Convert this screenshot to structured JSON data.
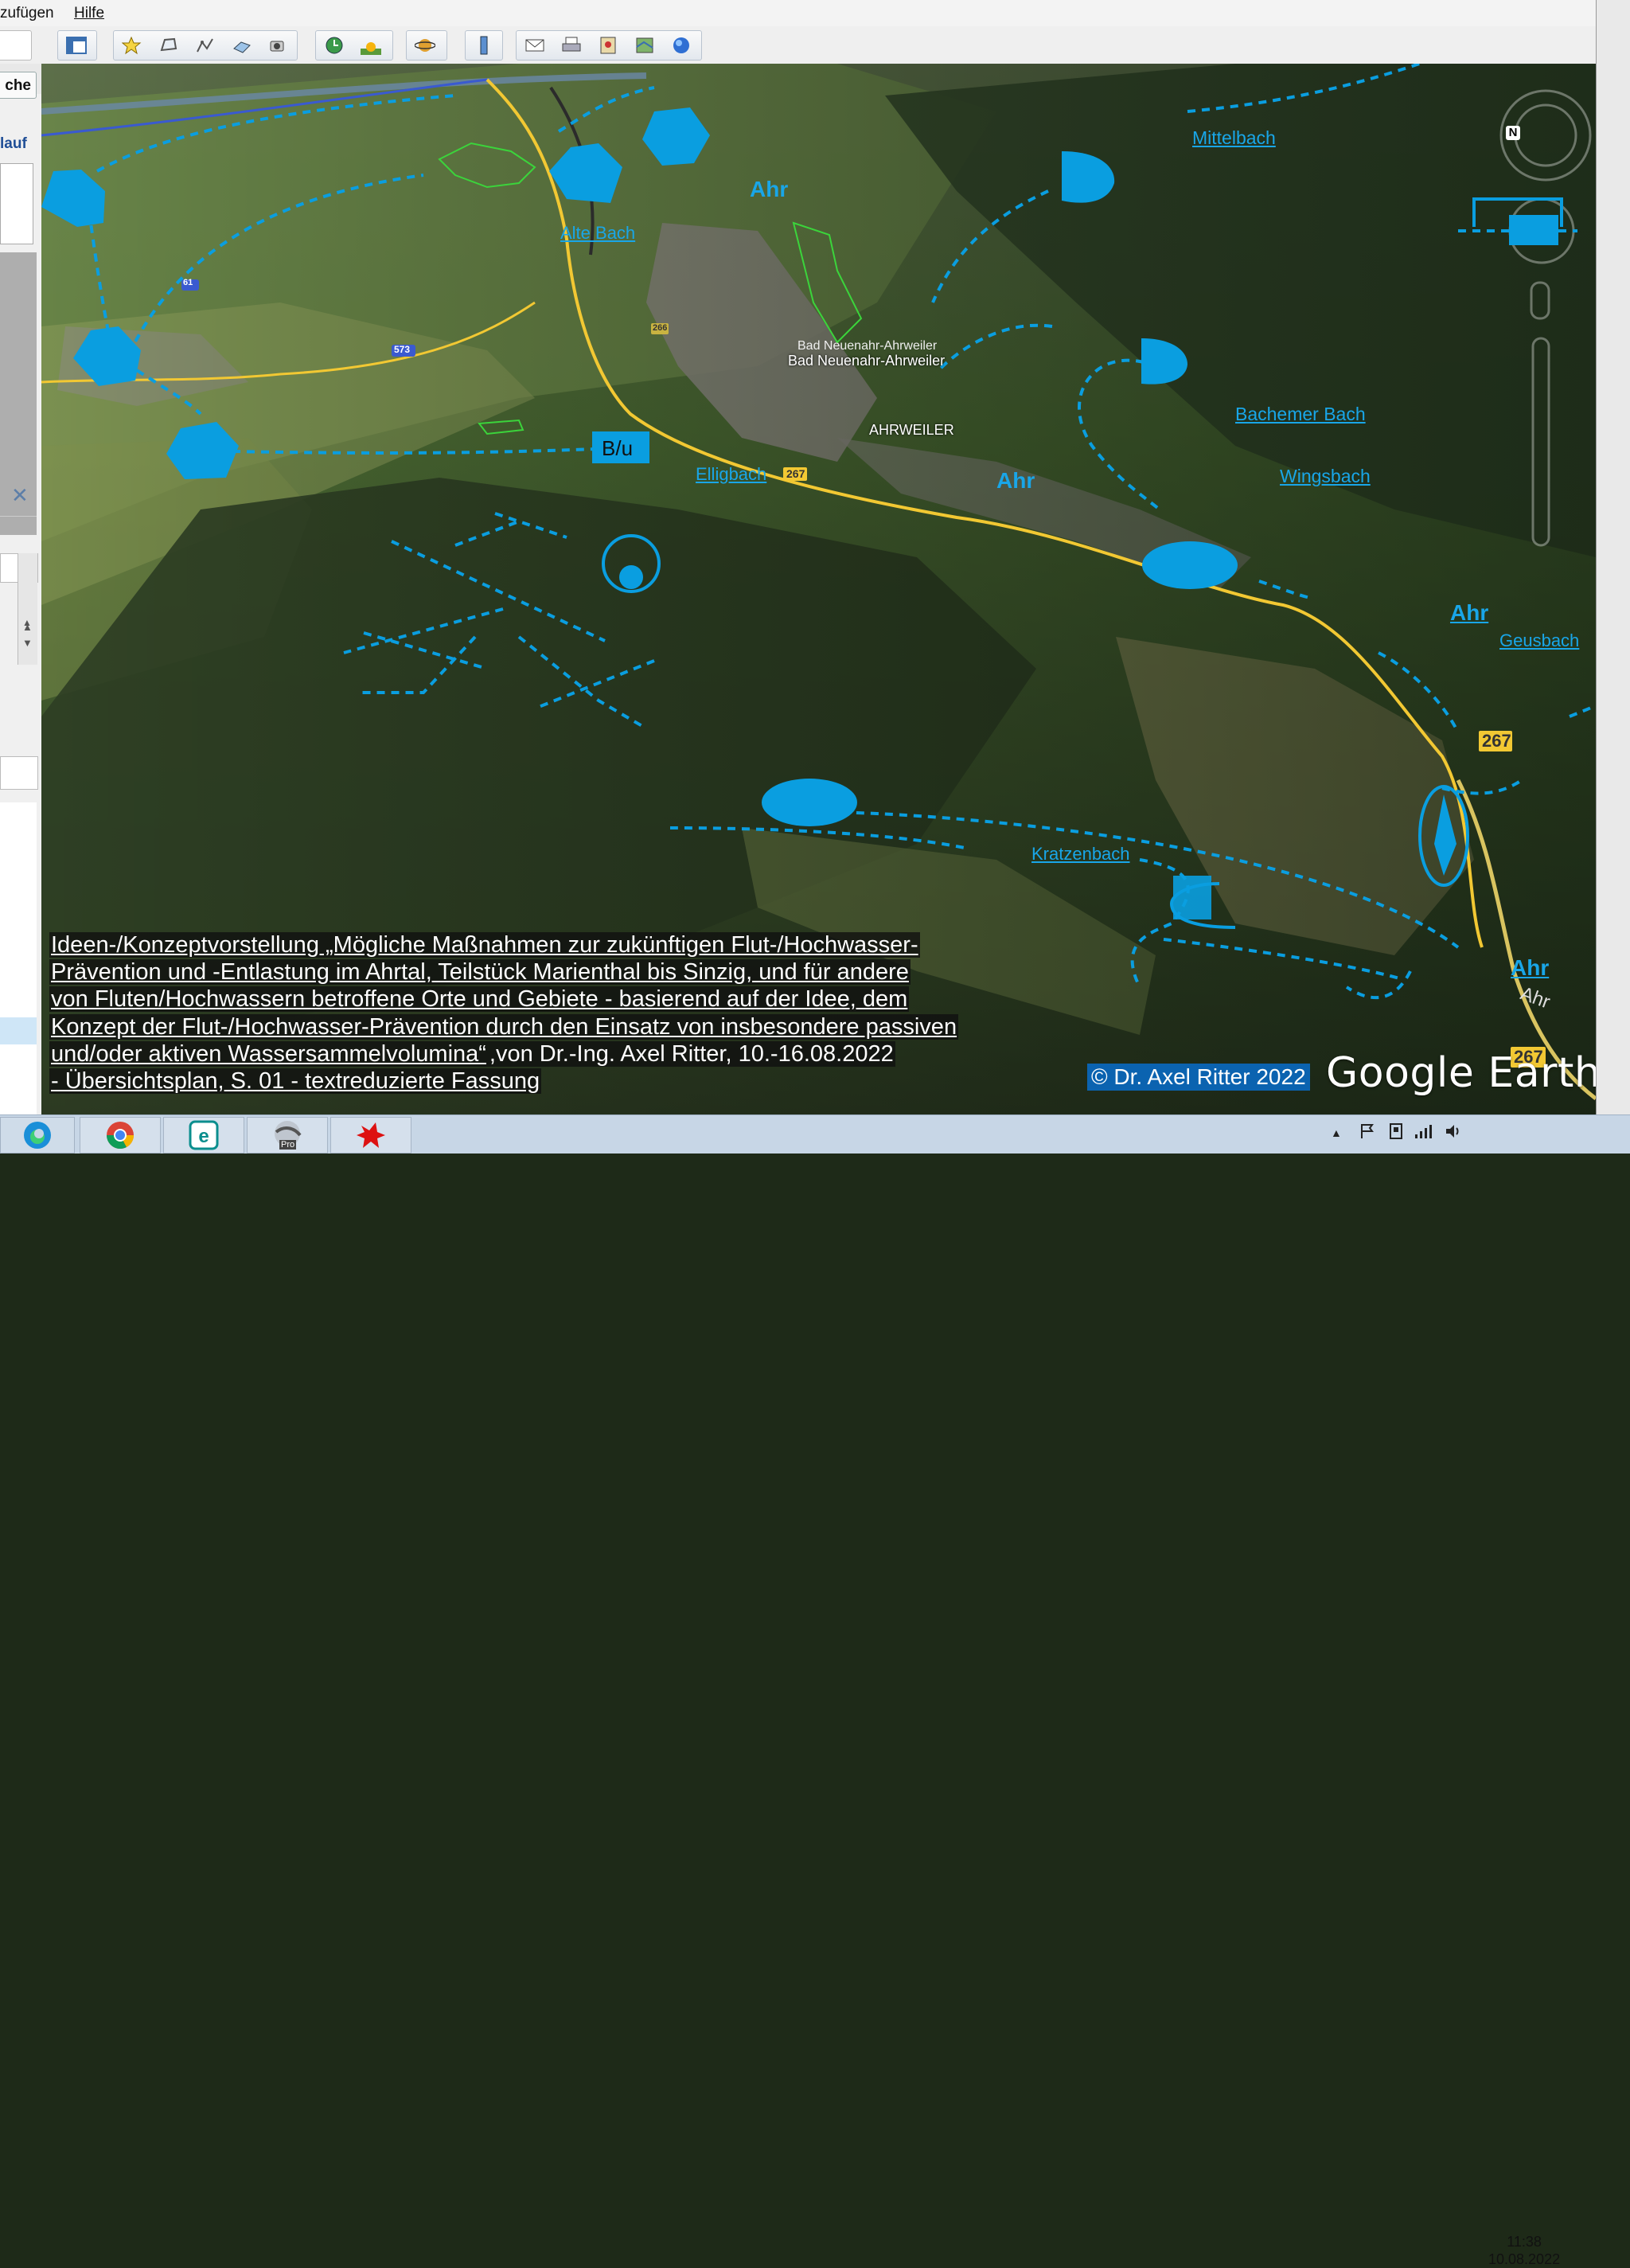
{
  "menu": {
    "items": [
      "zufügen",
      "Hilfe"
    ]
  },
  "leftpanel": {
    "search_btn": "che",
    "history_label": "lauf",
    "close_glyph": "✕"
  },
  "map": {
    "labels": {
      "mittelbach": "Mittelbach",
      "alte_bach": "Alte Bach",
      "ahr_1": "Ahr",
      "ahr_2": "Ahr",
      "ahr_3": "Ahr",
      "ahr_4": "Ahr",
      "ahr_road": "Ahr",
      "bachemer_bach": "Bachemer Bach",
      "wingsbach": "Wingsbach",
      "elligbach": "Elligbach",
      "geusbach": "Geusbach",
      "kraetzenbach": "Kratzenbach",
      "city_a": "Bad Neuenahr-Ahrweiler",
      "city_b": "Bad Neuenahr-Ahrweiler",
      "ahrweiler": "AHRWEILER",
      "bu_box": "B/u"
    },
    "road_signs": {
      "r61": "61",
      "r573": "573",
      "r266": "266",
      "r267a": "267",
      "r267b": "267",
      "r267c": "267"
    },
    "compass_letter": "N",
    "colors": {
      "accent_blue": "#0a9ee0",
      "label_blue": "#19a6e8",
      "road_yellow": "#f2c833",
      "outline_green": "#3bd43b"
    }
  },
  "caption": {
    "line1": "Ideen-/Konzeptvorstellung „Mögliche Maßnahmen zur zukünftigen Flut-/Hochwasser-",
    "line2": "Prävention und -Entlastung im Ahrtal, Teilstück Marienthal bis Sinzig, und für andere",
    "line3": "von Fluten/Hochwassern betroffene Orte und Gebiete - basierend auf der Idee, dem",
    "line4": "Konzept der Flut-/Hochwasser-Prävention durch den Einsatz von insbesondere passiven",
    "line5a": "und/oder aktiven Wassersammelvolumina“",
    "line5b": ",von Dr.-Ing. Axel Ritter, 10.-16.08.2022",
    "line6": "- Übersichtsplan, S. 01 - textreduzierte Fassung"
  },
  "copyright": "© Dr. Axel Ritter 2022",
  "brand": "Google Earth",
  "taskbar": {
    "apps": [
      "edge-icon",
      "chrome-icon",
      "eset-icon",
      "google-earth-pro-icon",
      "red-app-icon"
    ],
    "pro_badge": "Pro",
    "time": "11:38",
    "date": "10.08.2022"
  }
}
